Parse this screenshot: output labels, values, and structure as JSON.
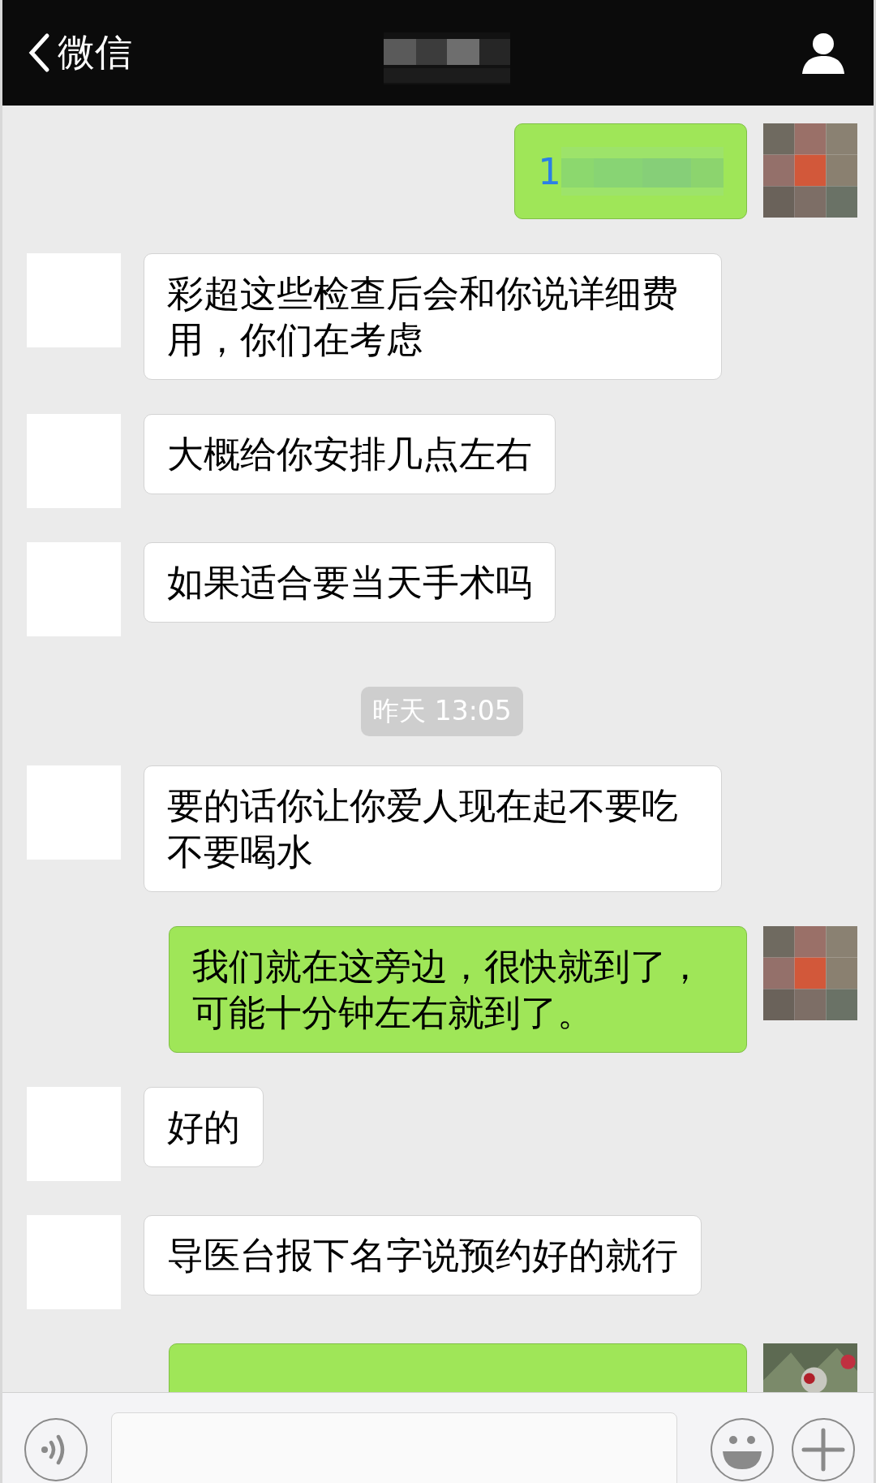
{
  "header": {
    "back_label": "微信"
  },
  "messages": [
    {
      "kind": "sent",
      "text": "1",
      "link": true,
      "redacted": true,
      "avatar": {
        "kind": "mosaic"
      }
    },
    {
      "kind": "received",
      "text": "彩超这些检查后会和你说详细费用，你们在考虑"
    },
    {
      "kind": "received",
      "text": "大概给你安排几点左右"
    },
    {
      "kind": "received",
      "text": "如果适合要当天手术吗"
    },
    {
      "kind": "timestamp",
      "text": "昨天 13:05"
    },
    {
      "kind": "received",
      "text": "要的话你让你爱人现在起不要吃不要喝水"
    },
    {
      "kind": "sent",
      "text": "我们就在这旁边，很快就到了，可能十分钟左右就到了。",
      "link": false,
      "redacted": false,
      "avatar": {
        "kind": "mosaic"
      }
    },
    {
      "kind": "received",
      "text": "好的"
    },
    {
      "kind": "received",
      "text": "导医台报下名字说预约好的就行"
    },
    {
      "kind": "sent"
    }
  ]
}
